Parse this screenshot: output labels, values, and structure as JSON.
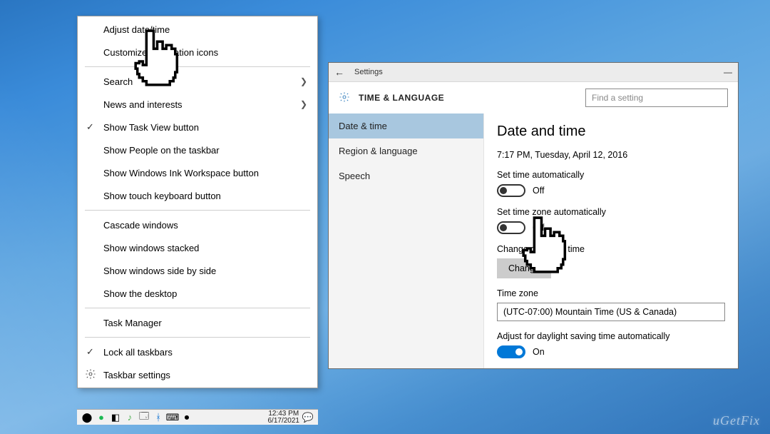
{
  "context_menu": {
    "items": [
      {
        "label": "Adjust date/time",
        "indicator": ""
      },
      {
        "label": "Customize notification icons",
        "indicator": ""
      },
      {
        "sep": true
      },
      {
        "label": "Search",
        "indicator": "arrow"
      },
      {
        "label": "News and interests",
        "indicator": "arrow"
      },
      {
        "label": "Show Task View button",
        "indicator": "check"
      },
      {
        "label": "Show People on the taskbar",
        "indicator": ""
      },
      {
        "label": "Show Windows Ink Workspace button",
        "indicator": ""
      },
      {
        "label": "Show touch keyboard button",
        "indicator": ""
      },
      {
        "sep": true
      },
      {
        "label": "Cascade windows",
        "indicator": ""
      },
      {
        "label": "Show windows stacked",
        "indicator": ""
      },
      {
        "label": "Show windows side by side",
        "indicator": ""
      },
      {
        "label": "Show the desktop",
        "indicator": ""
      },
      {
        "sep": true
      },
      {
        "label": "Task Manager",
        "indicator": ""
      },
      {
        "sep": true
      },
      {
        "label": "Lock all taskbars",
        "indicator": "check"
      },
      {
        "label": "Taskbar settings",
        "indicator": "gear"
      }
    ]
  },
  "settings": {
    "title_bar": {
      "label": "Settings"
    },
    "header": {
      "title": "TIME & LANGUAGE",
      "search_placeholder": "Find a setting"
    },
    "nav": {
      "items": [
        {
          "label": "Date & time",
          "active": true
        },
        {
          "label": "Region & language",
          "active": false
        },
        {
          "label": "Speech",
          "active": false
        }
      ]
    },
    "main": {
      "heading": "Date and time",
      "current_datetime": "7:17 PM, Tuesday, April 12, 2016",
      "set_time_auto": {
        "label": "Set time automatically",
        "state": "Off",
        "on": false
      },
      "set_tz_auto": {
        "label": "Set time zone automatically",
        "state": "Off",
        "on": false
      },
      "change_section": {
        "label": "Change date and time",
        "button": "Change"
      },
      "timezone_label": "Time zone",
      "timezone_value": "(UTC-07:00) Mountain Time (US & Canada)",
      "dst": {
        "label": "Adjust for daylight saving time automatically",
        "state": "On",
        "on": true
      }
    }
  },
  "taskbar": {
    "clock_time": "12:43 PM",
    "clock_date": "6/17/2021"
  },
  "watermark": "uGetFix"
}
